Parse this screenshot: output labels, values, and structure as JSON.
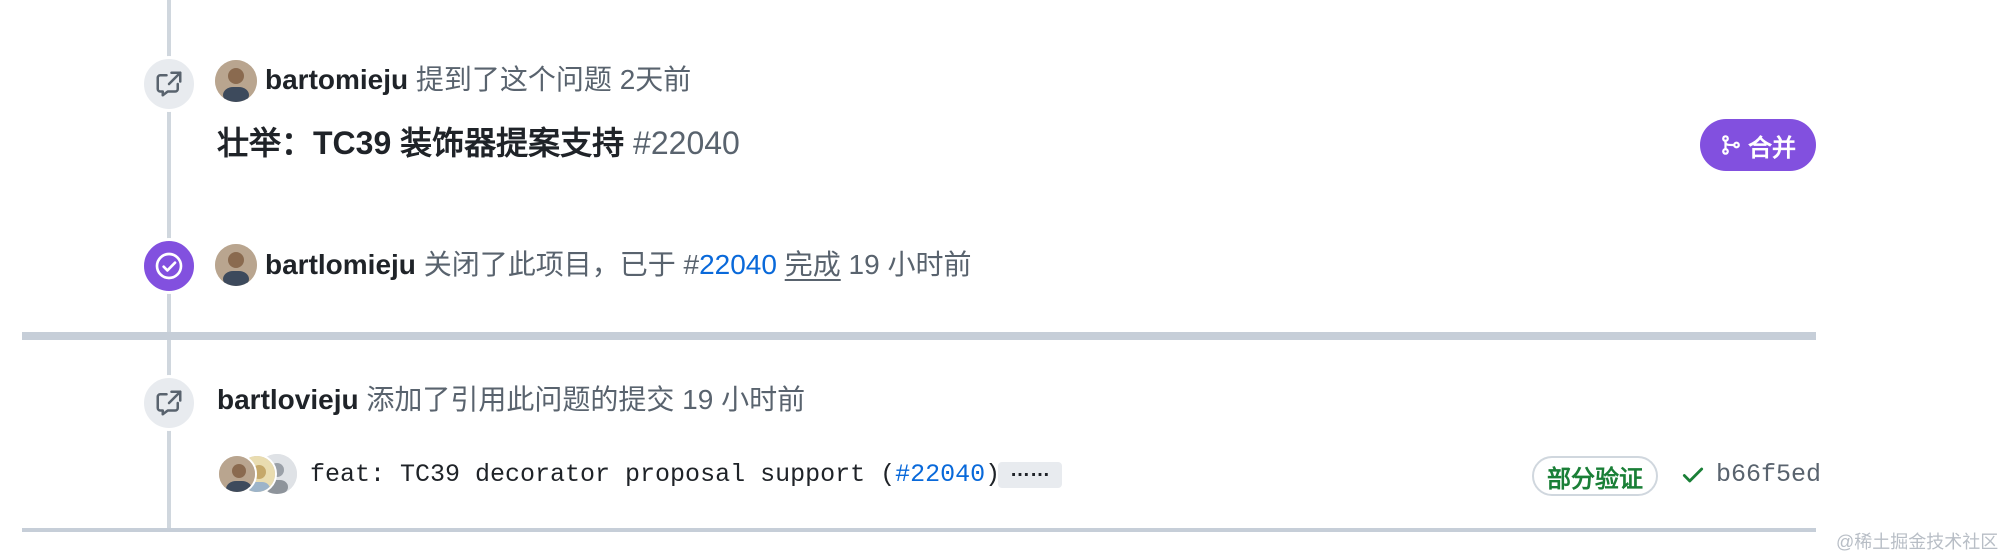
{
  "event1": {
    "author": "bartomieju",
    "action": "提到了这个问题",
    "time": "2天前",
    "issue_title": "壮举：TC39 装饰器提案支持",
    "issue_number": "#22040",
    "status_label": "合并"
  },
  "event2": {
    "author": "bartlomieju",
    "action": "关闭了此项目，已于 #",
    "pr_number": "22040",
    "done": "完成",
    "time": "19 小时前"
  },
  "event3": {
    "author": "bartlovieju",
    "action": "添加了引用此问题的提交",
    "time": "19 小时前",
    "commit_message_prefix": "feat: TC39 decorator proposal support (",
    "commit_ref": "#22040",
    "commit_message_suffix": ")",
    "more_label": "……",
    "verification_label": "部分验证",
    "sha": "b66f5ed"
  },
  "watermark": "@稀土掘金技术社区",
  "colors": {
    "purple": "#8250df",
    "link": "#0969da",
    "green": "#1a7f37"
  },
  "icons": [
    "cross-reference-icon",
    "check-circle-icon",
    "merge-icon",
    "check-icon"
  ]
}
